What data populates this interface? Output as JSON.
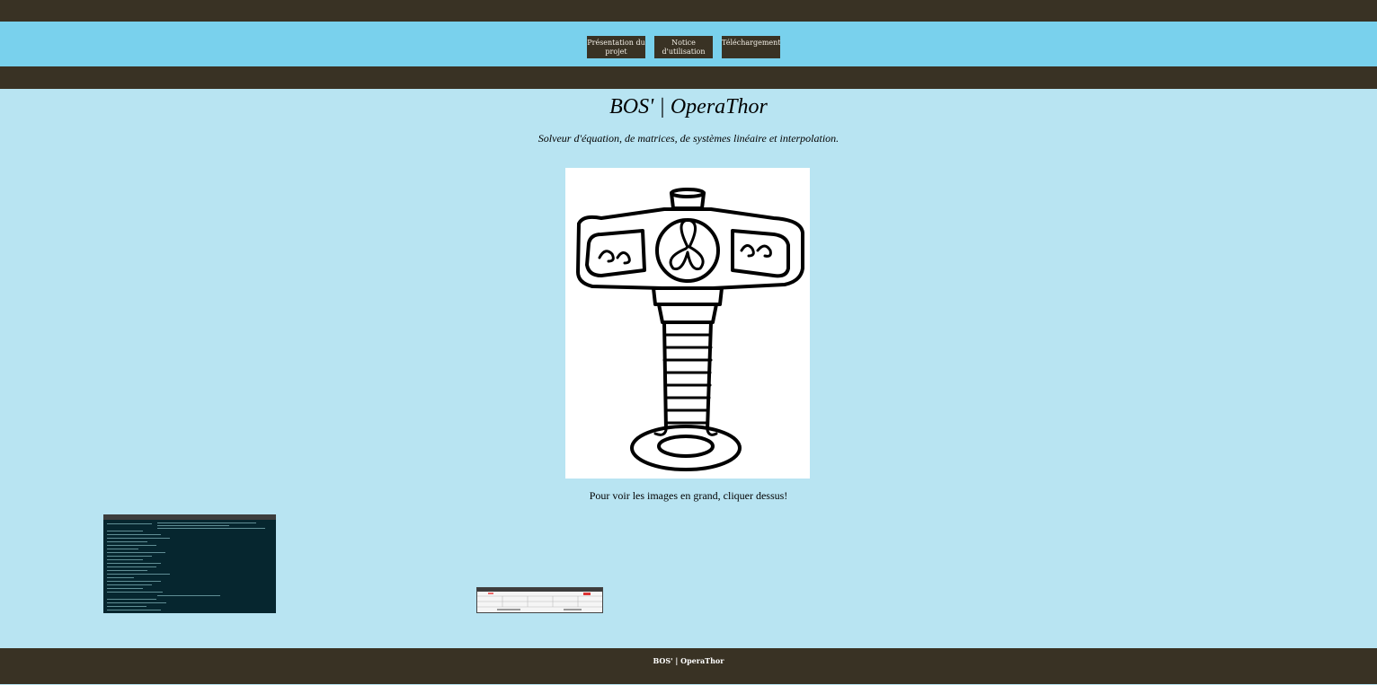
{
  "header": {
    "nav": [
      {
        "label": "Présentation du projet"
      },
      {
        "label": "Notice d'utilisation"
      },
      {
        "label": "Téléchargement"
      }
    ]
  },
  "main": {
    "title": "BOS' | OperaThor",
    "subtitle": "Solveur d'équation, de matrices, de systèmes linéaire et interpolation.",
    "hero_image": "hammer-logo-icon",
    "hint": "Pour voir les images en grand, cliquer dessus!"
  },
  "gallery": {
    "items": [
      {
        "icon": "terminal-screenshot-icon"
      },
      {
        "icon": "table-screenshot-icon"
      }
    ]
  },
  "footer": {
    "text": "BOS' | OperaThor"
  },
  "colors": {
    "dark": "#393224",
    "nav_bg": "#79d1ed",
    "page_bg": "#b8e4f2"
  }
}
